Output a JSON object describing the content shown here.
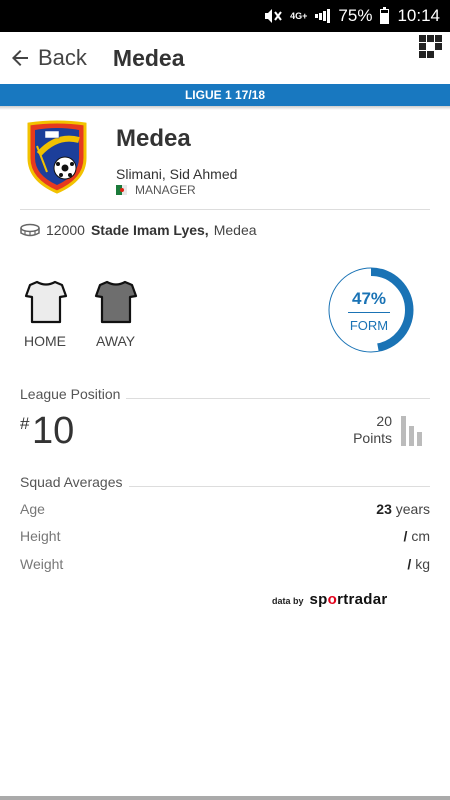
{
  "status_bar": {
    "network": "4G+",
    "battery": "75%",
    "time": "10:14"
  },
  "toolbar": {
    "back_label": "Back",
    "title": "Medea"
  },
  "league": {
    "label": "LIGUE 1 17/18"
  },
  "team": {
    "name": "Medea",
    "manager_name": "Slimani, Sid Ahmed",
    "manager_role": "MANAGER",
    "crest_text": "OLYMPIQUE DE MEDEA"
  },
  "stadium": {
    "capacity": "12000",
    "name": "Stade Imam Lyes,",
    "city": "Medea"
  },
  "kits": {
    "home_label": "HOME",
    "away_label": "AWAY"
  },
  "form": {
    "value": "47%",
    "label": "FORM",
    "fraction": 0.47
  },
  "league_position": {
    "title": "League Position",
    "hash": "#",
    "position": "10",
    "points_value": "20",
    "points_label": "Points"
  },
  "squad_averages": {
    "title": "Squad Averages",
    "age_label": "Age",
    "age_value": "23",
    "age_unit": "years",
    "height_label": "Height",
    "height_value": "/",
    "height_unit": "cm",
    "weight_label": "Weight",
    "weight_value": "/",
    "weight_unit": "kg"
  },
  "credit": {
    "prefix": "data by",
    "brand_a": "sp",
    "brand_accent": "o",
    "brand_b": "rtradar"
  },
  "colors": {
    "accent": "#1878c0",
    "form": "#1a73b5"
  }
}
